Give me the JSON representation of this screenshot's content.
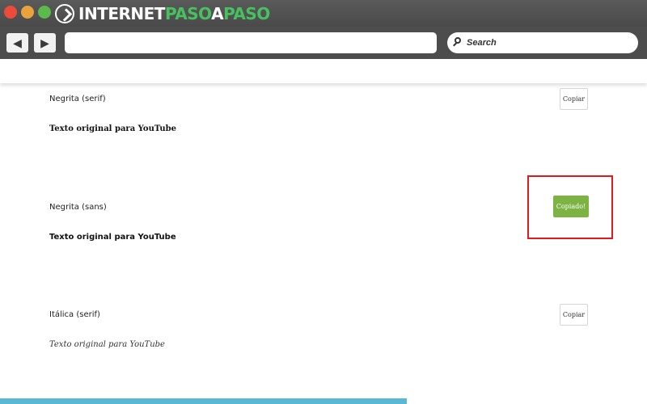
{
  "window": {
    "logo_part1": "INTERNET",
    "logo_part2": "PASO",
    "logo_part3": "A",
    "logo_part4": "PASO",
    "colors": {
      "logo_white": "#ffffff",
      "logo_green": "#48c060"
    }
  },
  "toolbar": {
    "back_glyph": "◀",
    "forward_glyph": "▶",
    "address_value": "",
    "search_label": "Search"
  },
  "rows": [
    {
      "label": "Negrita (serif)",
      "sample": "Texto original para YouTube",
      "button": "Copiar"
    },
    {
      "label": "Negrita (sans)",
      "sample": "Texto original para YouTube",
      "button": "Copiado!"
    },
    {
      "label": "Itálica (serif)",
      "sample": "Texto original para YouTube",
      "button": "Copiar"
    }
  ],
  "colors": {
    "copied_green": "#7cb342",
    "highlight_red": "#e01b1b",
    "bottom_bar": "#5bb8d4"
  }
}
